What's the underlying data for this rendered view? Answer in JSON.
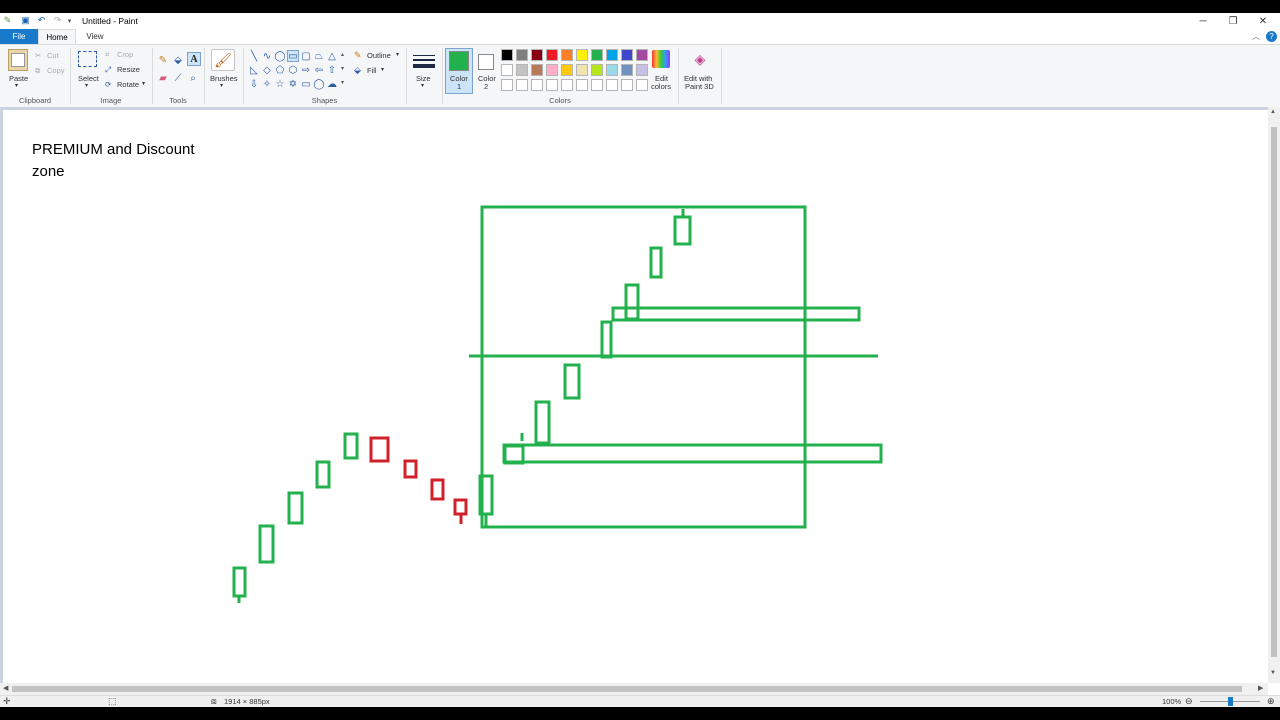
{
  "window": {
    "title": "Untitled - Paint",
    "controls": {
      "minimize": "─",
      "restore": "❐",
      "close": "✕"
    }
  },
  "tabs": [
    {
      "label": "File"
    },
    {
      "label": "Home"
    },
    {
      "label": "View"
    }
  ],
  "ribbon": {
    "clipboard": {
      "label": "Clipboard",
      "paste": "Paste",
      "cut": "Cut",
      "copy": "Copy"
    },
    "image": {
      "label": "Image",
      "select": "Select",
      "crop": "Crop",
      "resize": "Resize",
      "rotate": "Rotate"
    },
    "tools": {
      "label": "Tools"
    },
    "brushes": {
      "label": "Brushes"
    },
    "shapes": {
      "label": "Shapes",
      "outline": "Outline",
      "fill": "Fill"
    },
    "size": {
      "label": "Size"
    },
    "colors": {
      "label": "Colors",
      "color1_line1": "Color",
      "color1_line2": "1",
      "color2_line1": "Color",
      "color2_line2": "2",
      "color1_value": "#22b14c",
      "color2_value": "#ffffff",
      "edit_colors_line1": "Edit",
      "edit_colors_line2": "colors",
      "paint3d_line1": "Edit with",
      "paint3d_line2": "Paint 3D",
      "palette_row1": [
        "#000000",
        "#7f7f7f",
        "#880015",
        "#ed1c24",
        "#ff7f27",
        "#fff200",
        "#22b14c",
        "#00a2e8",
        "#3f48cc",
        "#a349a4"
      ],
      "palette_row2": [
        "#ffffff",
        "#c3c3c3",
        "#b97a57",
        "#ffaec9",
        "#ffc90e",
        "#efe4b0",
        "#b5e61d",
        "#99d9ea",
        "#7092be",
        "#c8bfe7"
      ]
    }
  },
  "canvas": {
    "text_line1": "PREMIUM and Discount",
    "text_line2": "zone",
    "stroke_green": "#22b14c",
    "stroke_red": "#d0202a"
  },
  "status": {
    "dimensions": "1914 × 885px",
    "zoom": "100%"
  }
}
